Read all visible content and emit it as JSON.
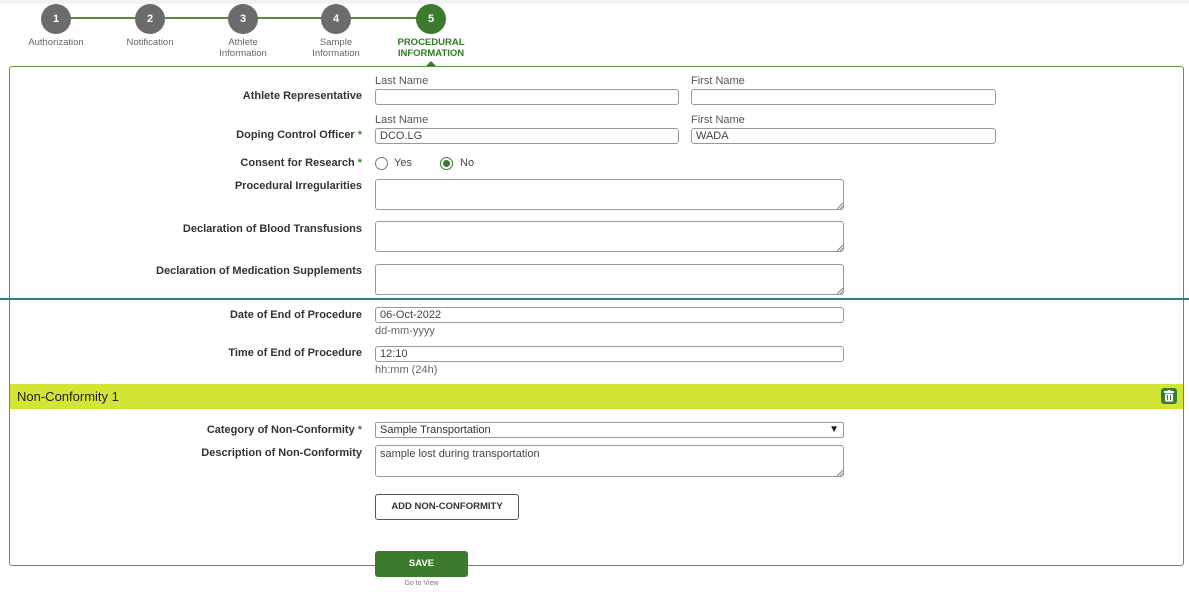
{
  "stepper": {
    "steps": [
      {
        "number": "1",
        "label": "Authorization",
        "active": false
      },
      {
        "number": "2",
        "label": "Notification",
        "active": false
      },
      {
        "number": "3",
        "label": "Athlete\nInformation",
        "active": false
      },
      {
        "number": "4",
        "label": "Sample\nInformation",
        "active": false
      },
      {
        "number": "5",
        "label": "PROCEDURAL\nINFORMATION",
        "active": true
      }
    ],
    "active_step": 5,
    "line_color": "#5a8a3c",
    "active_color": "#3c7a2e",
    "inactive_color": "#6b6b6b"
  },
  "form": {
    "athlete_representative": {
      "label": "Athlete Representative",
      "last_name_label": "Last Name",
      "first_name_label": "First Name",
      "last_name_value": "",
      "first_name_value": ""
    },
    "doping_control_officer": {
      "label": "Doping Control Officer",
      "required": "*",
      "last_name_label": "Last Name",
      "first_name_label": "First Name",
      "last_name_value": "DCO.LG",
      "first_name_value": "WADA"
    },
    "consent_for_research": {
      "label": "Consent for Research",
      "required": "*",
      "option_yes": "Yes",
      "option_no": "No",
      "selected": "No"
    },
    "procedural_irregularities": {
      "label": "Procedural Irregularities",
      "value": ""
    },
    "declaration_blood_transfusions": {
      "label": "Declaration of Blood Transfusions",
      "value": ""
    },
    "declaration_medication_supplements": {
      "label": "Declaration of Medication Supplements",
      "value": ""
    },
    "date_end_procedure": {
      "label": "Date of End of Procedure",
      "value": "06-Oct-2022",
      "hint": "dd-mm-yyyy"
    },
    "time_end_procedure": {
      "label": "Time of End of Procedure",
      "value": "12:10",
      "hint": "hh:mm (24h)"
    }
  },
  "non_conformity": {
    "title": "Non-Conformity 1",
    "category_label": "Category of Non-Conformity",
    "category_required": "*",
    "category_value": "Sample Transportation",
    "description_label": "Description of Non-Conformity",
    "description_value": "sample lost during transportation",
    "bar_color": "#d2e534"
  },
  "buttons": {
    "add_non_conformity": "ADD NON-CONFORMITY",
    "save": "SAVE",
    "go_to_view": "Go to View"
  }
}
